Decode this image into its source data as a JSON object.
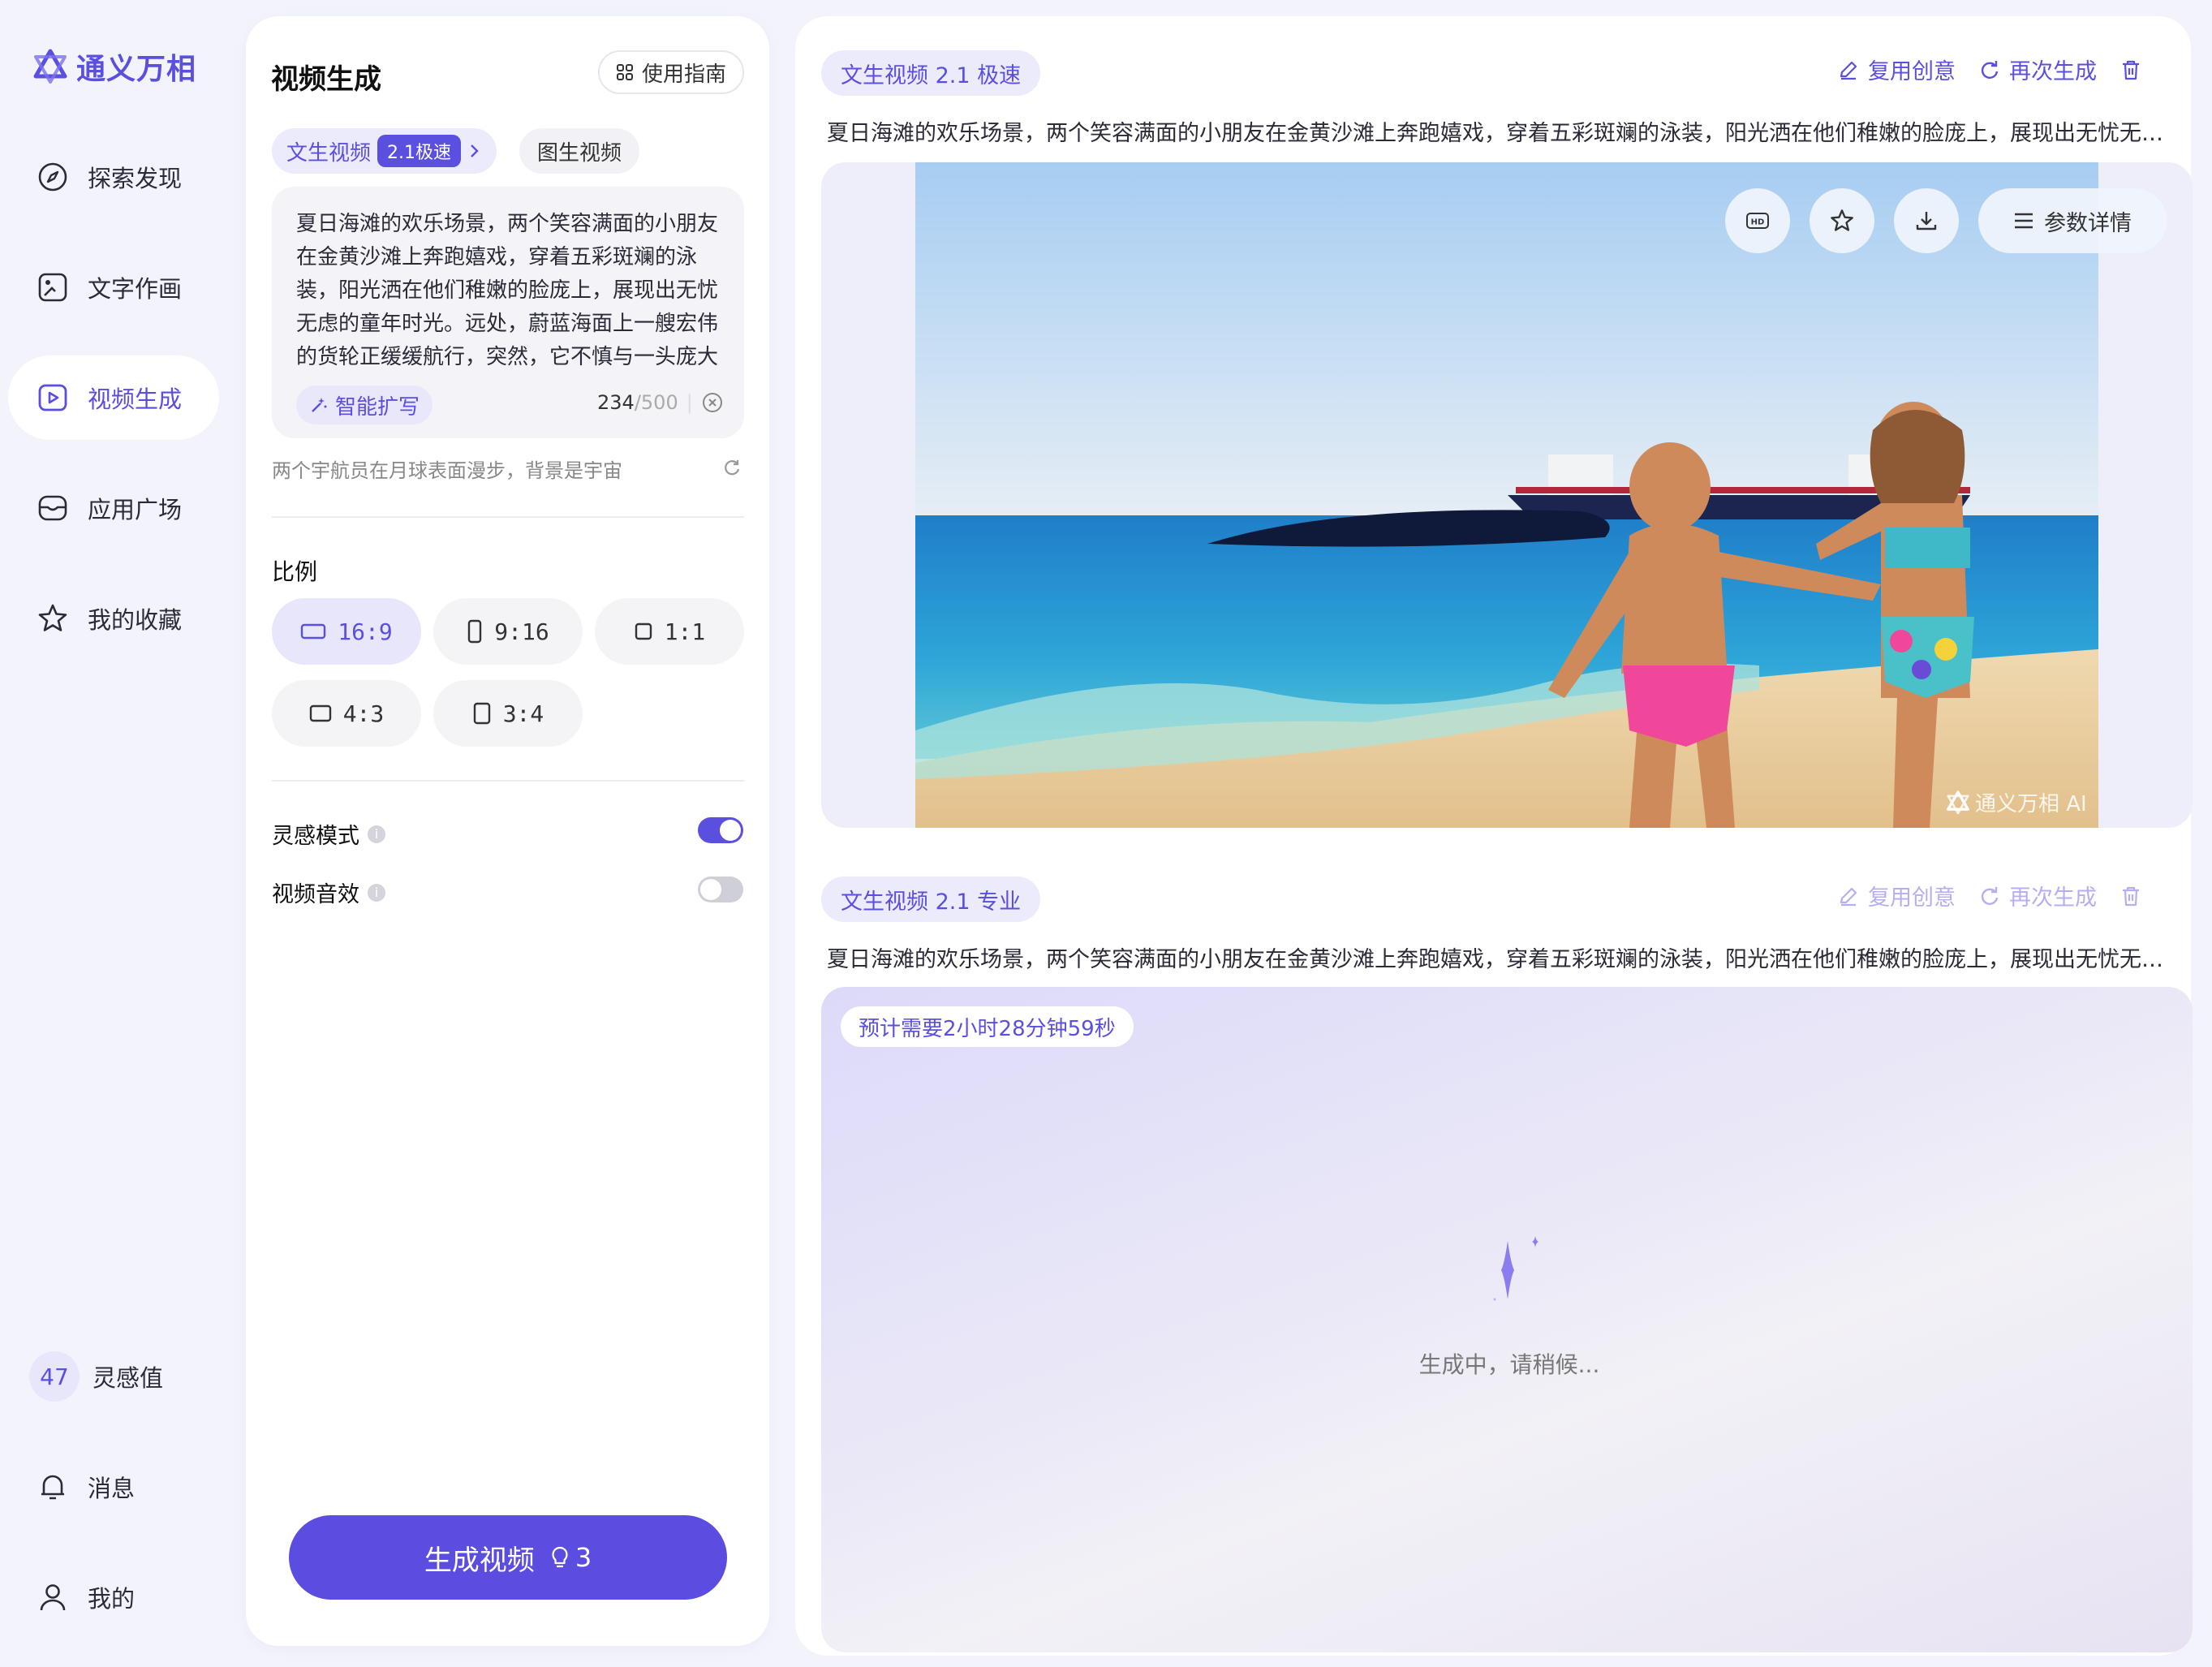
{
  "app": {
    "name": "通义万相",
    "accent": "#5b4fe0"
  },
  "sidebar": {
    "items": [
      {
        "label": "探索发现",
        "icon": "compass-icon"
      },
      {
        "label": "文字作画",
        "icon": "image-edit-icon"
      },
      {
        "label": "视频生成",
        "icon": "video-icon",
        "active": true
      },
      {
        "label": "应用广场",
        "icon": "store-icon"
      },
      {
        "label": "我的收藏",
        "icon": "star-icon"
      }
    ],
    "inspiration": {
      "value": "47",
      "label": "灵感值"
    },
    "messages_label": "消息",
    "profile_label": "我的"
  },
  "panel": {
    "title": "视频生成",
    "guide_label": "使用指南",
    "tabs": [
      {
        "label": "文生视频",
        "badge": "2.1极速",
        "active": true
      },
      {
        "label": "图生视频"
      }
    ],
    "prompt": "夏日海滩的欢乐场景，两个笑容满面的小朋友在金黄沙滩上奔跑嬉戏，穿着五彩斑斓的泳装，阳光洒在他们稚嫩的脸庞上，展现出无忧无虑的童年时光。远处，蔚蓝海面上一艘宏伟的货轮正缓缓航行，突然，它不慎与一头庞大",
    "smart_expand_label": "智能扩写",
    "char_count": "234",
    "char_limit": "/500",
    "suggestion": "两个宇航员在月球表面漫步，背景是宇宙",
    "ratio_label": "比例",
    "ratios": [
      {
        "label": "16:9",
        "active": true
      },
      {
        "label": "9:16"
      },
      {
        "label": "1:1"
      },
      {
        "label": "4:3"
      },
      {
        "label": "3:4"
      }
    ],
    "inspiration_mode": {
      "label": "灵感模式",
      "on": true
    },
    "video_sound": {
      "label": "视频音效",
      "on": false
    },
    "generate_label": "生成视频",
    "generate_cost": "3"
  },
  "results": [
    {
      "tag": "文生视频 2.1 极速",
      "reuse_label": "复用创意",
      "regen_label": "再次生成",
      "description": "夏日海滩的欢乐场景，两个笑容满面的小朋友在金黄沙滩上奔跑嬉戏，穿着五彩斑斓的泳装，阳光洒在他们稚嫩的脸庞上，展现出无忧无虑的童...",
      "params_label": "参数详情",
      "watermark": "通义万相 AI"
    },
    {
      "tag": "文生视频 2.1 专业",
      "reuse_label": "复用创意",
      "regen_label": "再次生成",
      "description": "夏日海滩的欢乐场景，两个笑容满面的小朋友在金黄沙滩上奔跑嬉戏，穿着五彩斑斓的泳装，阳光洒在他们稚嫩的脸庞上，展现出无忧无虑的童...",
      "eta": "预计需要2小时28分钟59秒",
      "status": "生成中，请稍候..."
    }
  ]
}
